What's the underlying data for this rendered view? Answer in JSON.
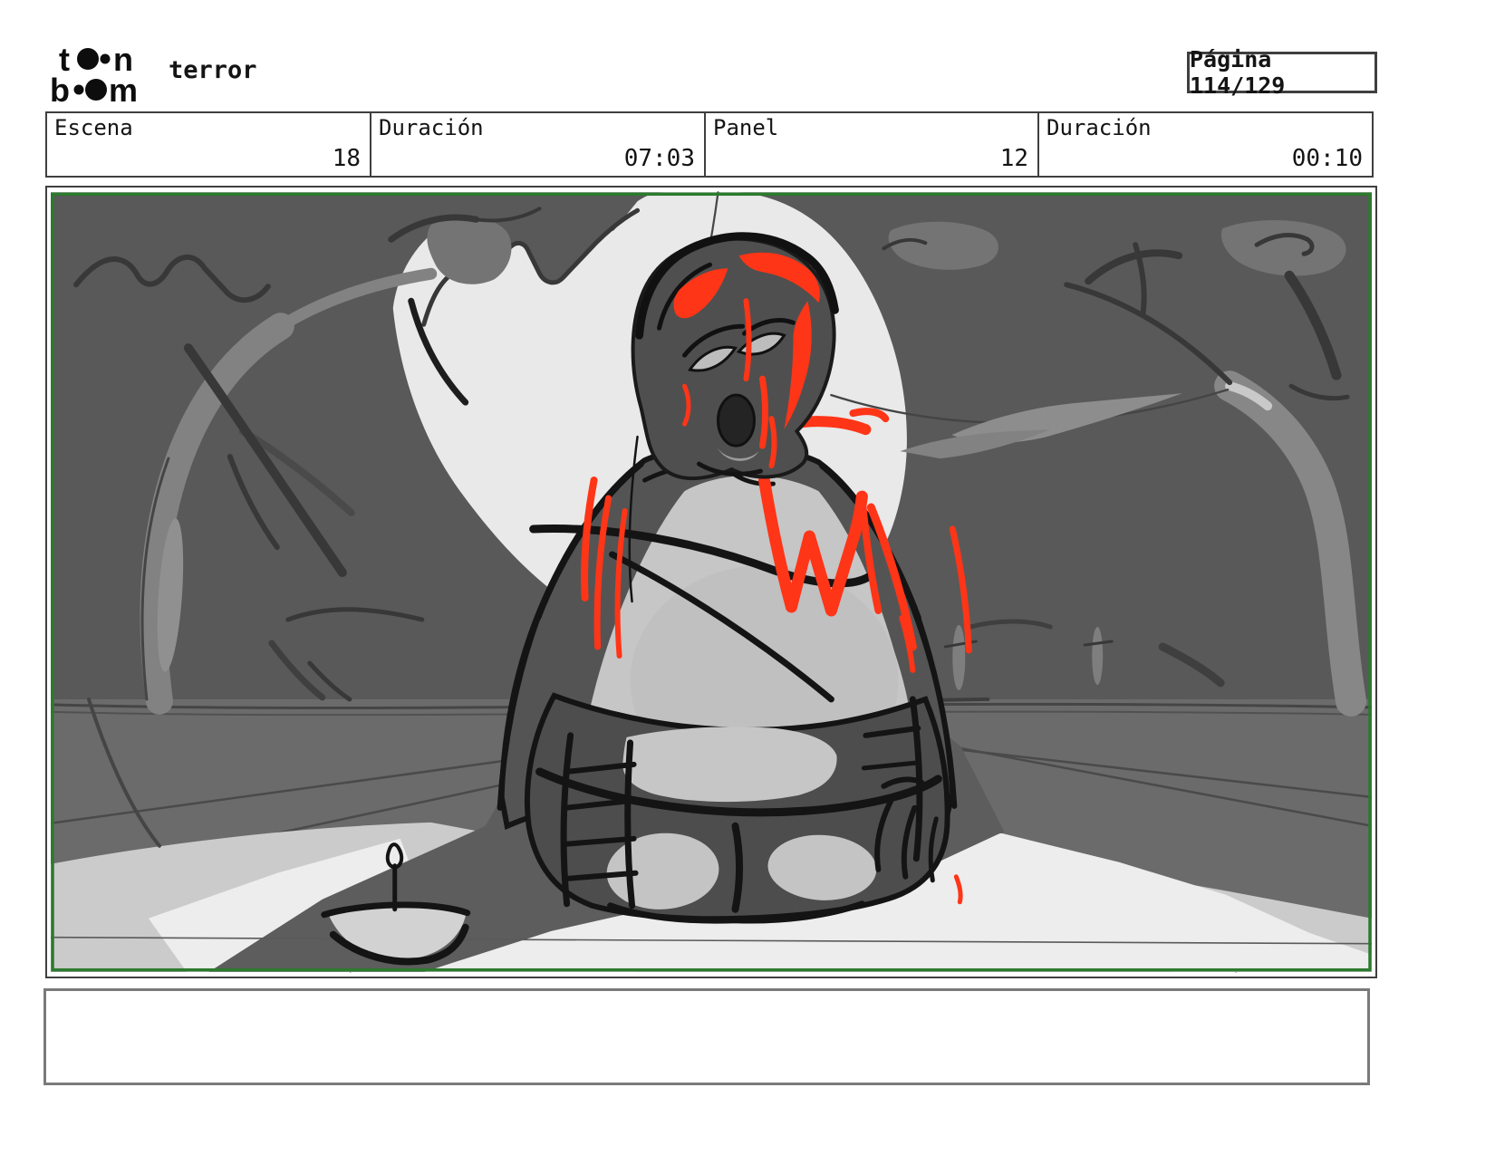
{
  "header": {
    "logo": {
      "name": "toonboom-logo",
      "l1_start": "t",
      "l1_end": "n",
      "l2_start": "b",
      "l2_end": "m"
    },
    "project_title": "terror",
    "page_label": "Página 114/129"
  },
  "info_bar": {
    "cells": [
      {
        "label": "Escena",
        "value": "18"
      },
      {
        "label": "Duración",
        "value": "07:03"
      },
      {
        "label": "Panel",
        "value": "12"
      },
      {
        "label": "Duración",
        "value": "00:10"
      }
    ]
  },
  "panel": {
    "description": "storyboard sketch: kneeling bleeding figure seen from behind before a full moon, bent trees, candle bowl on lit floor"
  },
  "caption": {
    "text": ""
  },
  "colors": {
    "frame_green": "#2c7a2e",
    "blood_red": "#ff3517",
    "bg_gray": "#595959",
    "floor_gray": "#6b6b6b",
    "moon_gray": "#e9e9e9",
    "cape_light": "#c6c6c6",
    "border_dark": "#3f3f3f",
    "caption_border": "#7a7a7a"
  }
}
